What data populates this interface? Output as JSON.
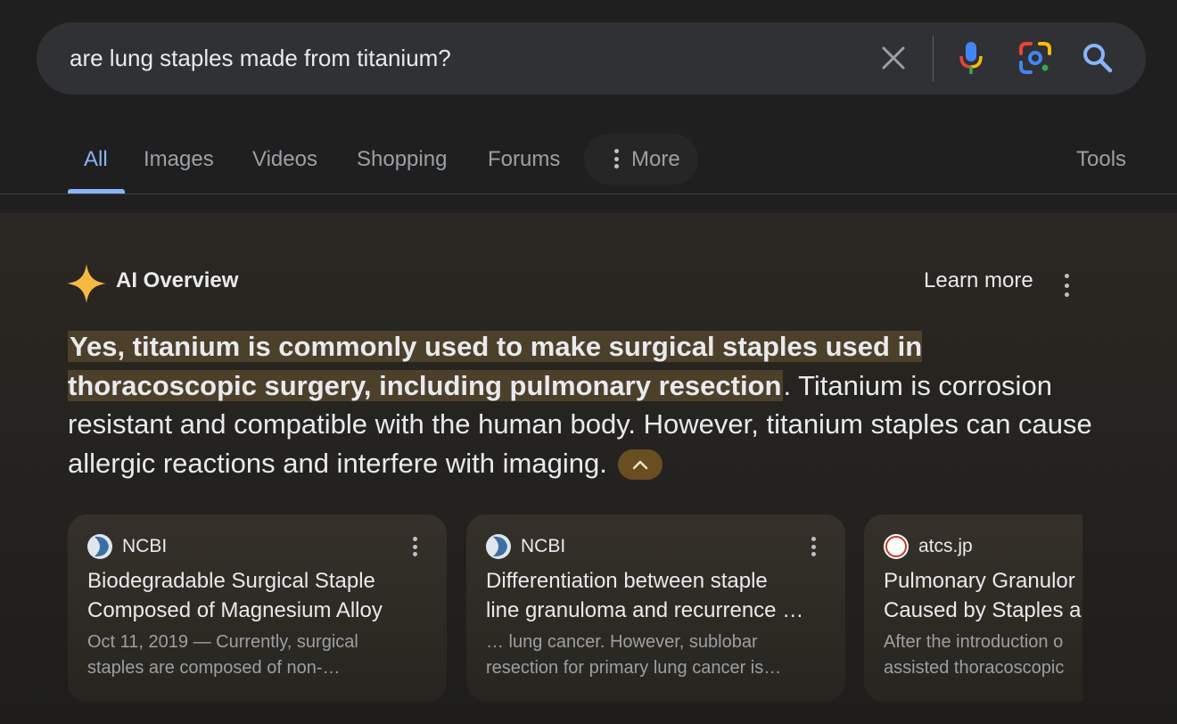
{
  "search": {
    "query": "are lung staples made from titanium?"
  },
  "icons": {
    "clear": "close-icon",
    "voice": "microphone-icon",
    "lens": "lens-camera-icon",
    "search": "search-icon"
  },
  "tabs": [
    {
      "label": "All",
      "active": true
    },
    {
      "label": "Images"
    },
    {
      "label": "Videos"
    },
    {
      "label": "Shopping"
    },
    {
      "label": "Forums"
    },
    {
      "label": "More"
    }
  ],
  "tools_label": "Tools",
  "ai_overview": {
    "title": "AI Overview",
    "learn_more": "Learn more",
    "highlight": "Yes, titanium is commonly used to make surgical staples used in thoracoscopic surgery, including pulmonary resection",
    "rest": ". Titanium is corrosion resistant and compatible with the human body. However, titanium staples can cause allergic reactions and interfere with imaging."
  },
  "sources": [
    {
      "site": "NCBI",
      "title_line1": "Biodegradable Surgical Staple",
      "title_line2": "Composed of Magnesium Alloy",
      "snippet_line1": "Oct 11, 2019 — Currently, surgical",
      "snippet_line2": "staples are composed of non-…"
    },
    {
      "site": "NCBI",
      "title_line1": "Differentiation between staple",
      "title_line2": "line granuloma and recurrence …",
      "snippet_line1": "… lung cancer. However, sublobar",
      "snippet_line2": "resection for primary lung cancer is…"
    },
    {
      "site": "atcs.jp",
      "logo_text": "ATCS",
      "title_line1": "Pulmonary Granulor",
      "title_line2": "Caused by Staples a",
      "snippet_line1": "After the introduction o",
      "snippet_line2": "assisted thoracoscopic"
    }
  ],
  "colors": {
    "accent_blue": "#8ab4f8",
    "highlight_bg": "#4d402b",
    "ai_star": "#f5b942"
  }
}
